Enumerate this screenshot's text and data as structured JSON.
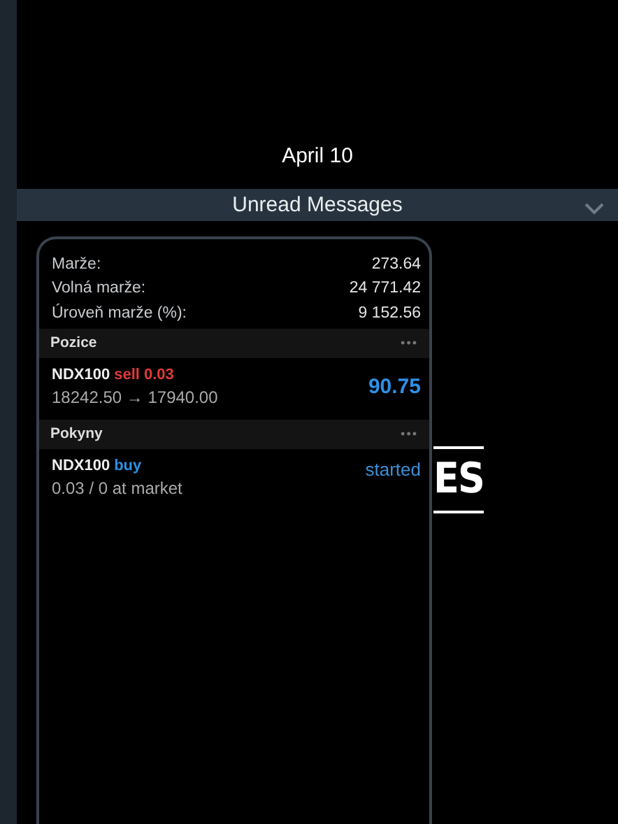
{
  "chat": {
    "date": "April 10",
    "unread_bar": {
      "label": "Unread Messages",
      "expanded": false
    }
  },
  "screenshot": {
    "account_rows": [
      {
        "label": "Marže:",
        "value": "273.64"
      },
      {
        "label": "Volná marže:",
        "value": "24 771.42"
      },
      {
        "label": "Úroveň marže (%):",
        "value": "9 152.56"
      }
    ],
    "sections": [
      {
        "title": "Pozice",
        "more": "•••",
        "items": [
          {
            "symbol": "NDX100",
            "kind": "sell",
            "side": "sell 0.03",
            "detail": "18242.50 → 17940.00",
            "result": {
              "text": "90.75",
              "kind": "profit"
            }
          }
        ]
      },
      {
        "title": "Pokyny",
        "more": "•••",
        "items": [
          {
            "symbol": "NDX100",
            "kind": "buy",
            "side": "buy",
            "detail": "0.03 / 0 at market",
            "result": {
              "text": "started",
              "kind": "status"
            }
          }
        ]
      }
    ]
  },
  "background_text": "ES"
}
